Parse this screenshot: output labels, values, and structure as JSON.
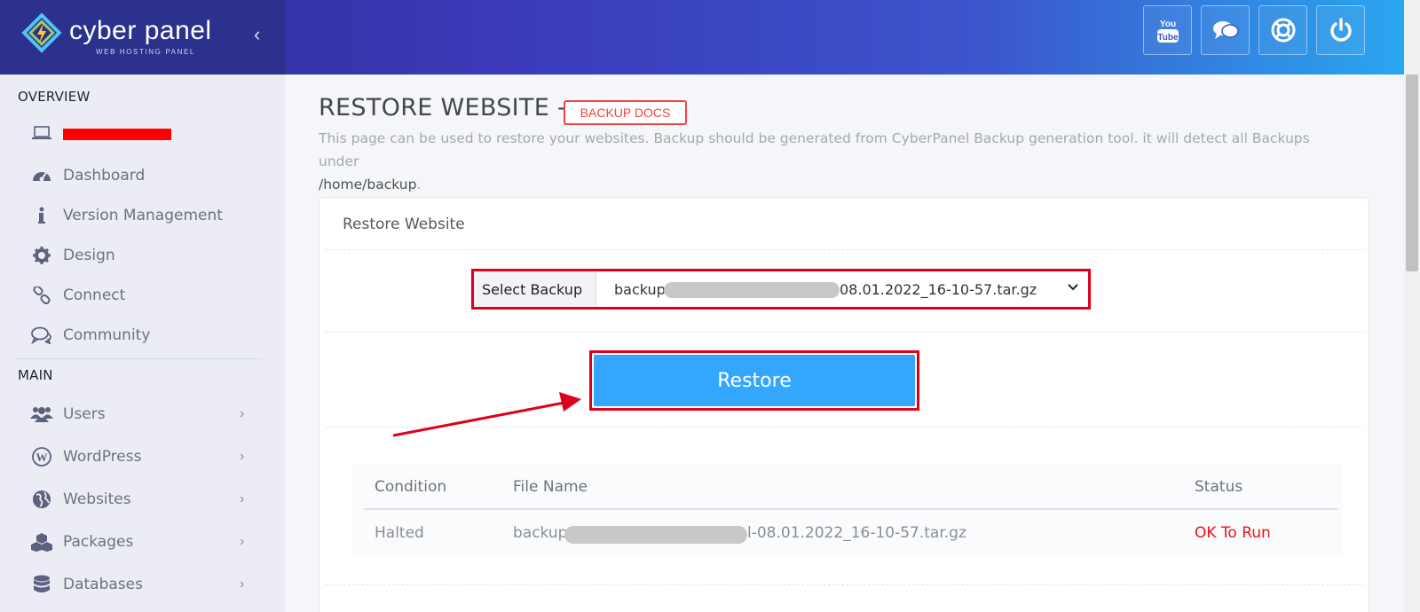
{
  "brand": {
    "name": "cyber panel",
    "subtitle": "WEB HOSTING PANEL"
  },
  "header": {
    "collapse_icon": "chevron-left-icon",
    "icons": [
      "youtube-icon",
      "chat-icon",
      "support-icon",
      "power-icon"
    ]
  },
  "sidebar": {
    "overview_title": "OVERVIEW",
    "main_title": "MAIN",
    "overview_items": [
      {
        "label": "",
        "icon": "laptop-icon"
      },
      {
        "label": "Dashboard",
        "icon": "dashboard-icon"
      },
      {
        "label": "Version Management",
        "icon": "info-icon"
      },
      {
        "label": "Design",
        "icon": "gear-icon"
      },
      {
        "label": "Connect",
        "icon": "link-icon"
      },
      {
        "label": "Community",
        "icon": "comments-icon"
      }
    ],
    "main_items": [
      {
        "label": "Users",
        "icon": "users-icon"
      },
      {
        "label": "WordPress",
        "icon": "wordpress-icon"
      },
      {
        "label": "Websites",
        "icon": "globe-icon"
      },
      {
        "label": "Packages",
        "icon": "cubes-icon"
      },
      {
        "label": "Databases",
        "icon": "database-icon"
      }
    ]
  },
  "page": {
    "title": "RESTORE WEBSITE -",
    "docs_badge": "BACKUP DOCS",
    "description": "This page can be used to restore your websites. Backup should be generated from CyberPanel Backup generation tool. it will detect all Backups under",
    "description_path": "/home/backup",
    "description_end": "."
  },
  "card": {
    "title": "Restore Website",
    "select_label": "Select Backup",
    "select_value_start": "backup",
    "select_value_end": "08.01.2022_16-10-57.tar.gz",
    "restore_button": "Restore"
  },
  "table": {
    "headers": [
      "Condition",
      "File Name",
      "Status"
    ],
    "rows": [
      {
        "condition": "Halted",
        "file_start": "backup",
        "file_end": "l-08.01.2022_16-10-57.tar.gz",
        "status": "OK To Run"
      }
    ]
  },
  "colors": {
    "accent": "#33a6fd",
    "annotation": "#e0001b",
    "status_ok": "#ee1111",
    "sidebar_bg": "#ecedf4"
  }
}
